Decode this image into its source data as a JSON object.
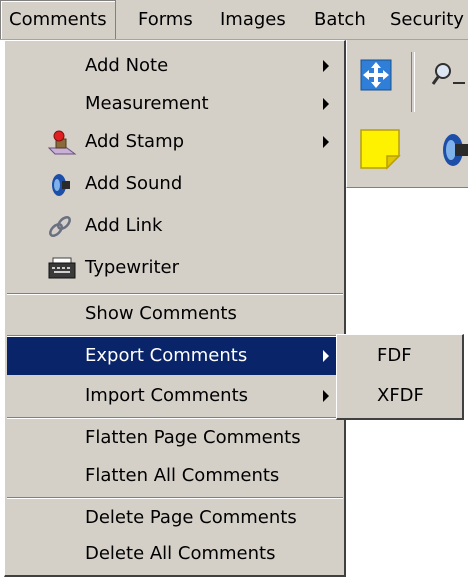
{
  "menubar": {
    "items": [
      {
        "label": "Comments"
      },
      {
        "label": "Forms"
      },
      {
        "label": "Images"
      },
      {
        "label": "Batch"
      },
      {
        "label": "Security"
      }
    ]
  },
  "menu": {
    "items": [
      {
        "label": "Add Note",
        "submenu": true
      },
      {
        "label": "Measurement",
        "submenu": true
      },
      {
        "label": "Add Stamp",
        "submenu": true,
        "icon": "stamp-icon"
      },
      {
        "label": "Add Sound",
        "icon": "sound-icon"
      },
      {
        "label": "Add Link",
        "icon": "link-icon"
      },
      {
        "label": "Typewriter",
        "icon": "typewriter-icon"
      },
      {
        "label": "Show Comments"
      },
      {
        "label": "Export Comments",
        "submenu": true,
        "highlighted": true
      },
      {
        "label": "Import Comments",
        "submenu": true
      },
      {
        "label": "Flatten Page Comments"
      },
      {
        "label": "Flatten All Comments"
      },
      {
        "label": "Delete Page Comments"
      },
      {
        "label": "Delete All Comments"
      }
    ]
  },
  "submenu": {
    "items": [
      {
        "label": "FDF"
      },
      {
        "label": "XFDF"
      }
    ]
  },
  "toolbar": {
    "icons": [
      "pan-icon",
      "zoom-icon",
      "sticky-note-icon",
      "sound-icon"
    ]
  },
  "colors": {
    "menu_bg": "#d4d0c8",
    "highlight": "#0a246a"
  }
}
